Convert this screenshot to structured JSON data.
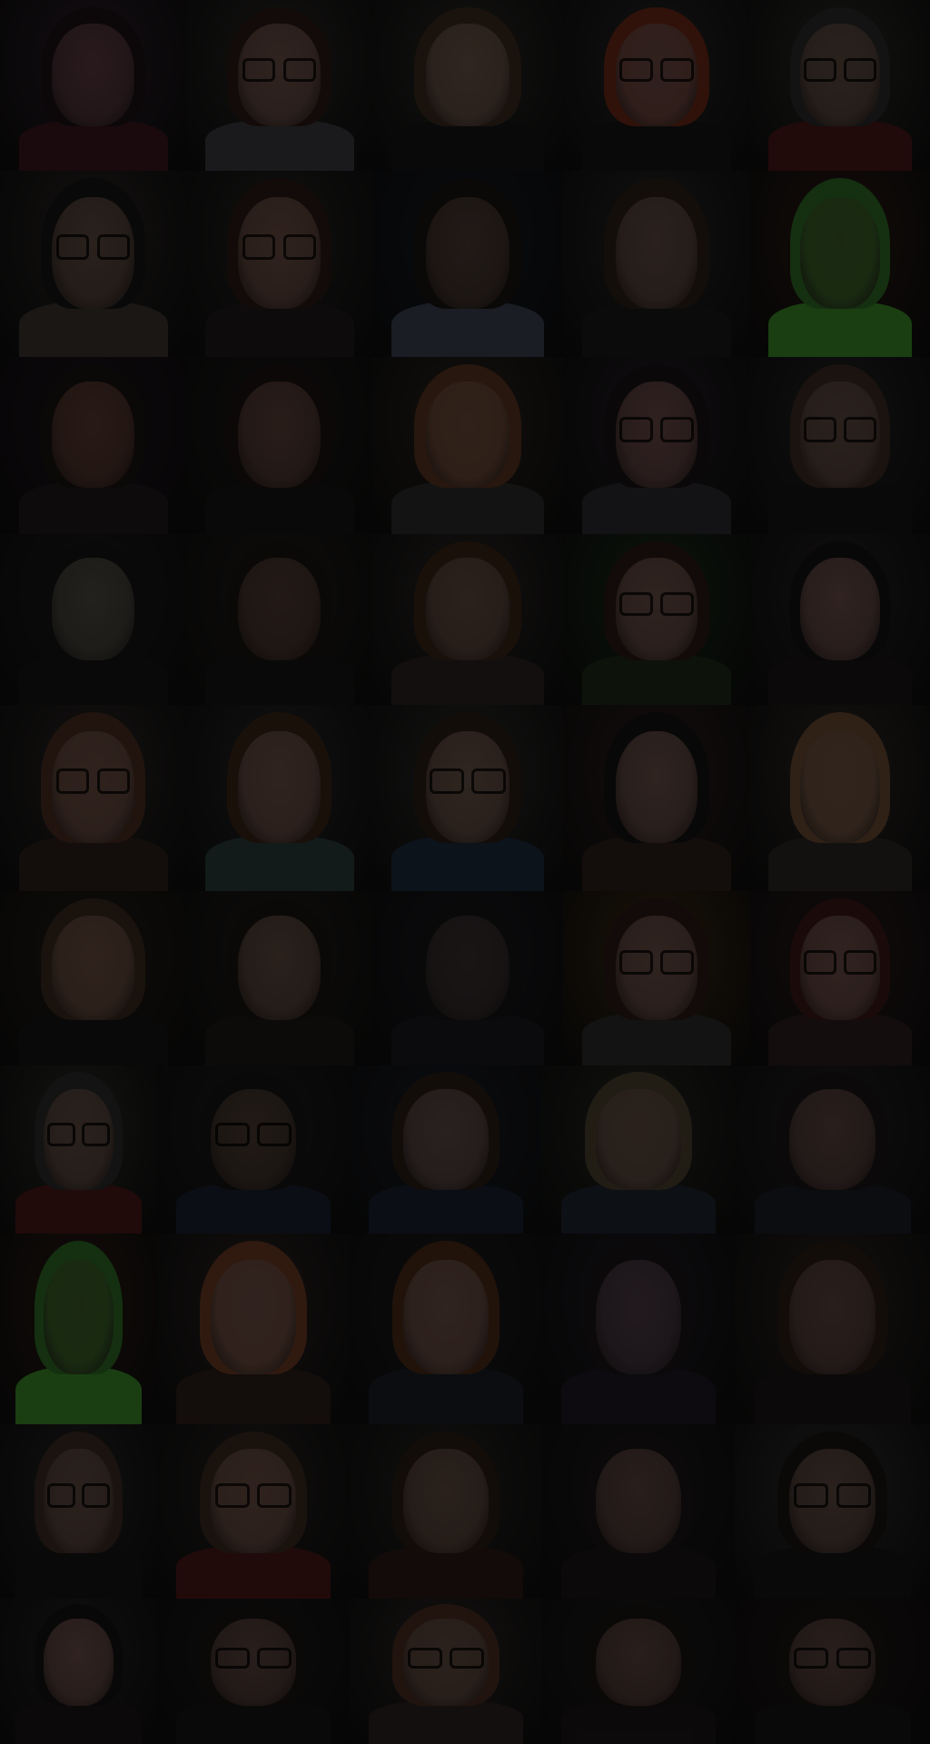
{
  "mosaic": {
    "description_free": true,
    "rows": [
      {
        "tiles": [
          {
            "bg": "#2a1e28",
            "skin": "#5a3a40",
            "hair": "#1c1016",
            "shirt": "#3a1820",
            "glasses": false
          },
          {
            "bg": "#2b2826",
            "skin": "#6a5048",
            "hair": "#2a1a14",
            "shirt": "#3a3a40",
            "glasses": true
          },
          {
            "bg": "#2a2826",
            "skin": "#6a5448",
            "hair": "#3a2a1e",
            "shirt": "#161414",
            "glasses": false
          },
          {
            "bg": "#262626",
            "skin": "#6a4a44",
            "hair": "#6a2818",
            "shirt": "#141414",
            "glasses": true
          },
          {
            "bg": "#2a2a26",
            "skin": "#5e4a40",
            "hair": "#2a2a2a",
            "shirt": "#4a1818",
            "glasses": true
          }
        ]
      },
      {
        "tiles": [
          {
            "bg": "#2a2624",
            "skin": "#5e4a40",
            "hair": "#141414",
            "shirt": "#3a3430",
            "glasses": true
          },
          {
            "bg": "#262422",
            "skin": "#6a4e44",
            "hair": "#2a1a14",
            "shirt": "#1e1a1a",
            "glasses": true
          },
          {
            "bg": "#161a22",
            "skin": "#4a3a34",
            "hair": "#1a1410",
            "shirt": "#3a4050",
            "glasses": false
          },
          {
            "bg": "#262626",
            "skin": "#5e4a42",
            "hair": "#2a2018",
            "shirt": "#1a1a1a",
            "glasses": false
          },
          {
            "bg": "#2a1a14",
            "skin": "#3a5a28",
            "hair": "#2e6a24",
            "shirt": "#3a8a28",
            "glasses": false
          }
        ]
      },
      {
        "tiles": [
          {
            "bg": "#1e141c",
            "skin": "#5a3a30",
            "hair": "#1a1212",
            "shirt": "#1e1a1a",
            "glasses": false
          },
          {
            "bg": "#1e1a18",
            "skin": "#5a4038",
            "hair": "#1a1210",
            "shirt": "#161414",
            "glasses": false
          },
          {
            "bg": "#2a241e",
            "skin": "#6a4a3a",
            "hair": "#5a3420",
            "shirt": "#2a2a2c",
            "glasses": false
          },
          {
            "bg": "#241e24",
            "skin": "#6a4a48",
            "hair": "#1a1216",
            "shirt": "#2a2a30",
            "glasses": true
          },
          {
            "bg": "#262424",
            "skin": "#5e4a42",
            "hair": "#3a2a22",
            "shirt": "#161414",
            "glasses": true
          }
        ]
      },
      {
        "tiles": [
          {
            "bg": "#1c1c1c",
            "skin": "#4e4a42",
            "hair": "#141414",
            "shirt": "#141414",
            "glasses": false
          },
          {
            "bg": "#221e1a",
            "skin": "#4e3a32",
            "hair": "#1a1410",
            "shirt": "#161414",
            "glasses": false
          },
          {
            "bg": "#2a2624",
            "skin": "#5e4a40",
            "hair": "#3a2418",
            "shirt": "#2a2220",
            "glasses": false
          },
          {
            "bg": "#1a2a18",
            "skin": "#6a5048",
            "hair": "#2a1a14",
            "shirt": "#1e2a1a",
            "glasses": true
          },
          {
            "bg": "#262224",
            "skin": "#6a4e48",
            "hair": "#161212",
            "shirt": "#1a1616",
            "glasses": false
          }
        ]
      },
      {
        "tiles": [
          {
            "bg": "#2a2624",
            "skin": "#6a4e44",
            "hair": "#4a2e20",
            "shirt": "#2a1e1a",
            "glasses": true
          },
          {
            "bg": "#262626",
            "skin": "#6a5048",
            "hair": "#3a2418",
            "shirt": "#2a3a3a",
            "glasses": false
          },
          {
            "bg": "#2a2a28",
            "skin": "#6a5448",
            "hair": "#2a1e16",
            "shirt": "#1e2a3a",
            "glasses": true
          },
          {
            "bg": "#2a1e1a",
            "skin": "#6a5048",
            "hair": "#161212",
            "shirt": "#2a1e1a",
            "glasses": false
          },
          {
            "bg": "#2e2824",
            "skin": "#6a5040",
            "hair": "#6a4a34",
            "shirt": "#2a2622",
            "glasses": false
          }
        ]
      },
      {
        "tiles": [
          {
            "bg": "#241e18",
            "skin": "#6a4e40",
            "hair": "#3a2a1e",
            "shirt": "#141414",
            "glasses": false
          },
          {
            "bg": "#221e1a",
            "skin": "#5e4a40",
            "hair": "#1a1410",
            "shirt": "#1e1a18",
            "glasses": false
          },
          {
            "bg": "#1a1a22",
            "skin": "#3a3030",
            "hair": "#141418",
            "shirt": "#1a1a20",
            "glasses": false
          },
          {
            "bg": "#3a2a14",
            "skin": "#6a5048",
            "hair": "#2a1a14",
            "shirt": "#2a2a2c",
            "glasses": true
          },
          {
            "bg": "#2a1a1a",
            "skin": "#6a4e48",
            "hair": "#3a1a18",
            "shirt": "#2a1e1e",
            "glasses": true
          }
        ]
      },
      {
        "tiles": [
          {
            "bg": "#2a2a26",
            "skin": "#5e4a40",
            "hair": "#2a2a2a",
            "shirt": "#4a1818",
            "glasses": true
          },
          {
            "bg": "#1e1e1e",
            "skin": "#4a3a30",
            "hair": "#141414",
            "shirt": "#1a2030",
            "glasses": true
          },
          {
            "bg": "#1a1e26",
            "skin": "#5a4a48",
            "hair": "#2a1e18",
            "shirt": "#1a2030",
            "glasses": false
          },
          {
            "bg": "#262622",
            "skin": "#5e4a40",
            "hair": "#4a4030",
            "shirt": "#1e2430",
            "glasses": false
          },
          {
            "bg": "#242222",
            "skin": "#5a4440",
            "hair": "#1a1614",
            "shirt": "#1a1e26",
            "glasses": false
          }
        ]
      },
      {
        "tiles": [
          {
            "bg": "#2a1a14",
            "skin": "#3a5a28",
            "hair": "#2e6a24",
            "shirt": "#3a8a28",
            "glasses": false
          },
          {
            "bg": "#2a2220",
            "skin": "#6a4e44",
            "hair": "#6a3a24",
            "shirt": "#2a1e1a",
            "glasses": false
          },
          {
            "bg": "#1e1c1c",
            "skin": "#6a5048",
            "hair": "#4a2a18",
            "shirt": "#1a1e24",
            "glasses": false
          },
          {
            "bg": "#1e1a22",
            "skin": "#4a3a44",
            "hair": "#1a1418",
            "shirt": "#1e1a22",
            "glasses": false
          },
          {
            "bg": "#2a2420",
            "skin": "#5a4440",
            "hair": "#2a1e18",
            "shirt": "#1a1616",
            "glasses": false
          }
        ]
      },
      {
        "tiles": [
          {
            "bg": "#262424",
            "skin": "#5e4a42",
            "hair": "#3a2a22",
            "shirt": "#161414",
            "glasses": true
          },
          {
            "bg": "#262220",
            "skin": "#6a4e44",
            "hair": "#3a2a1e",
            "shirt": "#4a1818",
            "glasses": true
          },
          {
            "bg": "#262422",
            "skin": "#5e4a40",
            "hair": "#2a1e16",
            "shirt": "#2a1818",
            "glasses": false
          },
          {
            "bg": "#1e1a1a",
            "skin": "#5a4440",
            "hair": "#1a1414",
            "shirt": "#1a1616",
            "glasses": false
          },
          {
            "bg": "#2c2c2e",
            "skin": "#5e4a42",
            "hair": "#1a1412",
            "shirt": "#161414",
            "glasses": true
          }
        ]
      },
      {
        "tiles": [
          {
            "bg": "#262224",
            "skin": "#6a4e48",
            "hair": "#161212",
            "shirt": "#1a1616",
            "glasses": false
          },
          {
            "bg": "#1a1a1a",
            "skin": "#5a4440",
            "hair": "#1a1410",
            "shirt": "#141414",
            "glasses": true
          },
          {
            "bg": "#2a2624",
            "skin": "#5e4a40",
            "hair": "#4a2e20",
            "shirt": "#2a2220",
            "glasses": true
          },
          {
            "bg": "#1e1c1c",
            "skin": "#5a4440",
            "hair": "#1a1410",
            "shirt": "#1a1616",
            "glasses": false
          },
          {
            "bg": "#1e1414",
            "skin": "#5a4440",
            "hair": "#1a1410",
            "shirt": "#161414",
            "glasses": true
          }
        ]
      }
    ]
  }
}
